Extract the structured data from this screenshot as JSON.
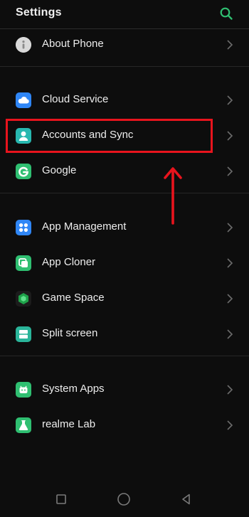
{
  "header": {
    "title": "Settings",
    "search_icon": "search-icon",
    "accent": "#2fbf71"
  },
  "groups": [
    [
      {
        "label": "About Phone",
        "icon": "info-icon",
        "color": "#d9d9d9"
      }
    ],
    [
      {
        "label": "Cloud Service",
        "icon": "cloud-icon",
        "color": "#2f86f6"
      },
      {
        "label": "Accounts and Sync",
        "icon": "person-icon",
        "color": "#28b8b0"
      },
      {
        "label": "Google",
        "icon": "google-g-icon",
        "color": "#2fbf71"
      }
    ],
    [
      {
        "label": "App Management",
        "icon": "apps-grid-icon",
        "color": "#2f86f6"
      },
      {
        "label": "App Cloner",
        "icon": "cloner-icon",
        "color": "#2fbf71"
      },
      {
        "label": "Game Space",
        "icon": "game-icon",
        "color": "#1fa34a"
      },
      {
        "label": "Split screen",
        "icon": "split-screen-icon",
        "color": "#2ab59a"
      }
    ],
    [
      {
        "label": "System Apps",
        "icon": "android-icon",
        "color": "#2fbf71"
      },
      {
        "label": "realme Lab",
        "icon": "flask-icon",
        "color": "#2fbf71"
      }
    ]
  ],
  "annotation": {
    "highlight_color": "#e8141d",
    "highlighted_item": "Accounts and Sync"
  },
  "navbar": {
    "buttons": [
      "recents-square-icon",
      "home-circle-icon",
      "back-triangle-icon"
    ]
  }
}
